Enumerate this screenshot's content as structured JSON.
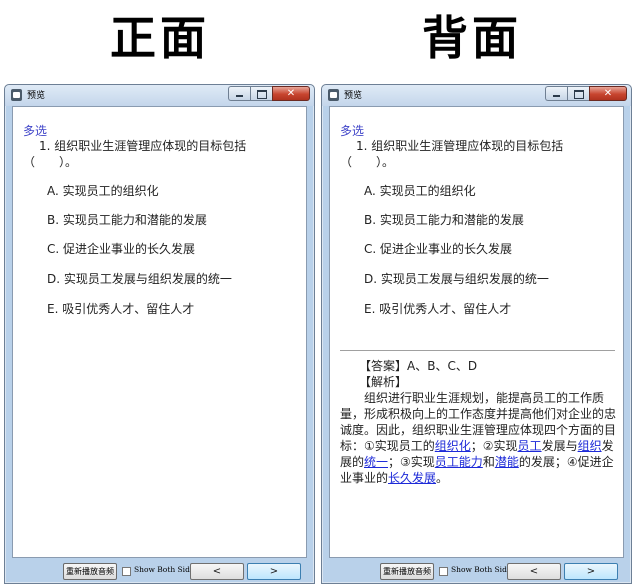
{
  "headings": {
    "front": "正面",
    "back": "背面"
  },
  "window": {
    "title": "预览",
    "replay_label": "重新播放音频",
    "show_both_label": "Show Both Sides",
    "prev_label": "<",
    "next_label": ">"
  },
  "question": {
    "type": "多选",
    "text": "1. 组织职业生涯管理应体现的目标包括（　　）。",
    "options": [
      "A. 实现员工的组织化",
      "B. 实现员工能力和潜能的发展",
      "C. 促进企业事业的长久发展",
      "D. 实现员工发展与组织发展的统一",
      "E. 吸引优秀人才、留住人才"
    ]
  },
  "answer": {
    "answer_line": "【答案】A、B、C、D",
    "analysis_heading": "【解析】",
    "analysis": {
      "t1": "组织进行职业生涯规划，能提高员工的工作质量，形成积极向上的工作态度并提高他们对企业的忠诚度。因此，组织职业生涯管理应体现四个方面的目标：①实现员工的",
      "l1": "组织化",
      "t2": "；②实现",
      "l2": "员工",
      "t3": "发展与",
      "l3": "组织",
      "t4": "发展的",
      "l4": "统一",
      "t5": "；③实现",
      "l5": "员工能力",
      "t6": "和",
      "l6": "潜能",
      "t7": "的发展；④促进企业事业的",
      "l7": "长久发展",
      "t8": "。"
    }
  }
}
